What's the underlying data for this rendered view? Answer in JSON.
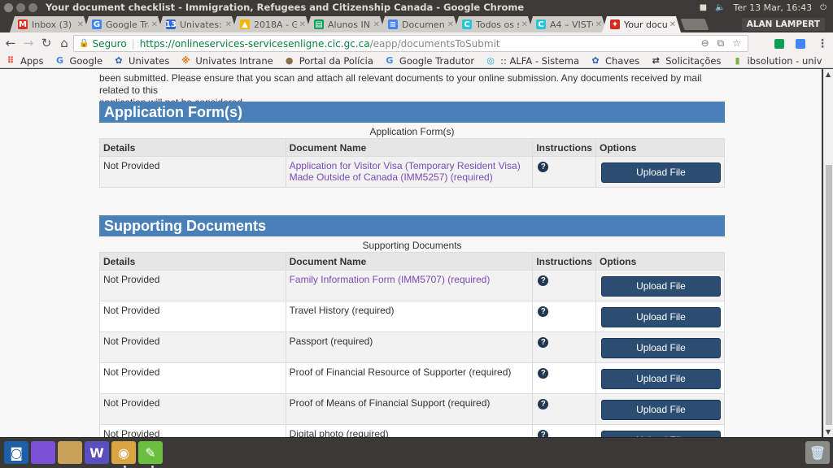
{
  "window": {
    "title": "Your document checklist - Immigration, Refugees and Citizenship Canada - Google Chrome",
    "clock": "Ter 13 Mar, 16:43",
    "user": "ALAN LAMPERT"
  },
  "tabs": [
    {
      "label": "Inbox (3) -",
      "icon": "gmail-icon",
      "color": "#d93025",
      "glyph": "M",
      "active": false
    },
    {
      "label": "Google Tra",
      "icon": "google-translate-icon",
      "color": "#4285f4",
      "glyph": "G",
      "active": false
    },
    {
      "label": "Univates:",
      "icon": "calendar-icon",
      "color": "#3367d6",
      "glyph": "13",
      "active": false
    },
    {
      "label": "2018A - Go",
      "icon": "google-drive-icon",
      "color": "#f4b400",
      "glyph": "▲",
      "active": false
    },
    {
      "label": "Alunos IN",
      "icon": "google-sheets-icon",
      "color": "#0f9d58",
      "glyph": "▤",
      "active": false
    },
    {
      "label": "Document",
      "icon": "google-docs-icon",
      "color": "#4285f4",
      "glyph": "≡",
      "active": false
    },
    {
      "label": "Todos os s",
      "icon": "c-app-icon",
      "color": "#26c6da",
      "glyph": "C",
      "active": false
    },
    {
      "label": "A4 – VISTO",
      "icon": "c-app-icon",
      "color": "#26c6da",
      "glyph": "C",
      "active": false
    },
    {
      "label": "Your docu",
      "icon": "maple-leaf-icon",
      "color": "#d52b1e",
      "glyph": "✦",
      "active": true
    }
  ],
  "omnibox": {
    "secure_label": "Seguro",
    "url_host": "https://onlineservices-servicesenligne.cic.gc.ca",
    "url_path": "/eapp/documentsToSubmit"
  },
  "bookmarks": [
    {
      "label": "Apps",
      "icon": "apps-grid-icon",
      "glyph": "⠿",
      "color": "#e94235"
    },
    {
      "label": "Google",
      "icon": "google-icon",
      "glyph": "G",
      "color": "#4285f4"
    },
    {
      "label": "Univates",
      "icon": "univates-icon",
      "glyph": "✿",
      "color": "#2a5db0"
    },
    {
      "label": "Univates Intrane",
      "icon": "intranet-icon",
      "glyph": "※",
      "color": "#e8710a"
    },
    {
      "label": "Portal da Polícia",
      "icon": "police-badge-icon",
      "glyph": "●",
      "color": "#8d6e4a"
    },
    {
      "label": "Google Tradutor",
      "icon": "google-translate-icon",
      "glyph": "G",
      "color": "#4285f4"
    },
    {
      "label": ":: ALFA - Sistema",
      "icon": "alfa-icon",
      "glyph": "◎",
      "color": "#29a3d6"
    },
    {
      "label": "Chaves",
      "icon": "univates-icon",
      "glyph": "✿",
      "color": "#2a5db0"
    },
    {
      "label": "Solicitações",
      "icon": "arrows-icon",
      "glyph": "⇄",
      "color": "#333"
    },
    {
      "label": "ibsolution - univ",
      "icon": "flag-icon",
      "glyph": "▮",
      "color": "#7cb342"
    }
  ],
  "page": {
    "intro_line1": "been submitted. Please ensure that you scan and attach all relevant documents to your online submission.  Any documents received by mail related to this",
    "intro_line2": "application will not be considered.",
    "columns": {
      "details": "Details",
      "document_name": "Document Name",
      "instructions": "Instructions",
      "options": "Options"
    },
    "upload_label": "Upload File",
    "help_glyph": "?",
    "sections": [
      {
        "title": "Application Form(s)",
        "caption": "Application Form(s)",
        "rows": [
          {
            "details": "Not Provided",
            "document": "Application for Visitor Visa (Temporary Resident Visa) Made Outside of Canada (IMM5257)  (required)",
            "link": true
          }
        ]
      },
      {
        "title": "Supporting Documents",
        "caption": "Supporting Documents",
        "rows": [
          {
            "details": "Not Provided",
            "document": "Family Information Form (IMM5707)  (required)",
            "link": true
          },
          {
            "details": "Not Provided",
            "document": "Travel History  (required)",
            "link": false
          },
          {
            "details": "Not Provided",
            "document": "Passport  (required)",
            "link": false
          },
          {
            "details": "Not Provided",
            "document": "Proof of Financial Resource of Supporter  (required)",
            "link": false
          },
          {
            "details": "Not Provided",
            "document": "Proof of Means of Financial Support  (required)",
            "link": false
          },
          {
            "details": "Not Provided",
            "document": "Digital photo  (required)",
            "link": false
          }
        ]
      }
    ]
  },
  "dock": [
    {
      "name": "ubuntu-dash-icon",
      "color": "#1d5fa8",
      "glyph": "◙"
    },
    {
      "name": "workspace-switcher-icon",
      "color": "#7b4fd6",
      "glyph": ""
    },
    {
      "name": "files-folder-icon",
      "color": "#c9a25a",
      "glyph": ""
    },
    {
      "name": "wps-writer-icon",
      "color": "#5a4fc0",
      "glyph": "W"
    },
    {
      "name": "chrome-icon",
      "color": "#d9a441",
      "glyph": "◉"
    },
    {
      "name": "green-app-icon",
      "color": "#6abf3f",
      "glyph": "✎"
    }
  ],
  "trash_icon": "trash-icon"
}
